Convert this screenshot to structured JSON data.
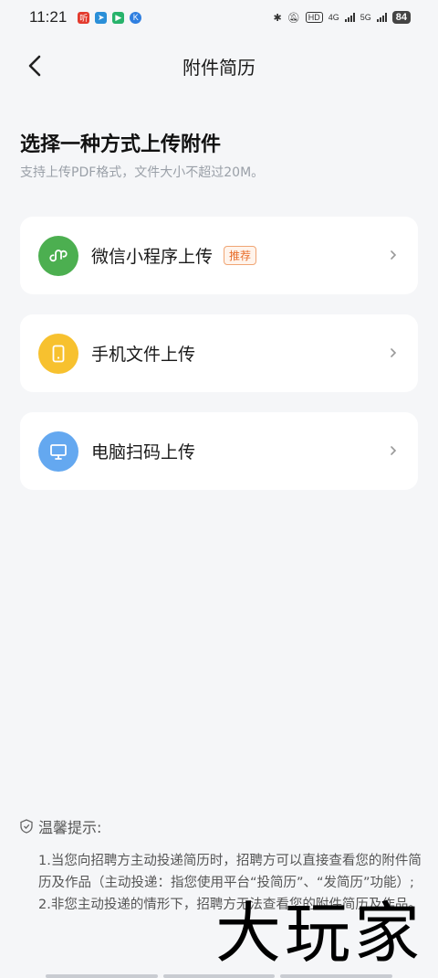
{
  "status_bar": {
    "time": "11:21",
    "apps": [
      {
        "icon": "ting-app-icon",
        "glyph": "听",
        "color": "#e33b2e"
      },
      {
        "icon": "telegram-icon",
        "glyph": "➤",
        "color": "#2a8fd8"
      },
      {
        "icon": "play-icon",
        "glyph": "▶",
        "color": "#27b36b"
      },
      {
        "icon": "k-app-icon",
        "glyph": "K",
        "color": "#2f7fe0"
      }
    ],
    "network_labels": [
      "HD",
      "4G",
      "5G"
    ],
    "battery": "84"
  },
  "nav": {
    "title": "附件简历"
  },
  "intro": {
    "heading": "选择一种方式上传附件",
    "subheading": "支持上传PDF格式，文件大小不超过20M。"
  },
  "options": [
    {
      "label": "微信小程序上传",
      "badge": "推荐",
      "icon": "wechat-miniprogram-icon",
      "icon_color": "#4caf50"
    },
    {
      "label": "手机文件上传",
      "badge": "",
      "icon": "phone-icon",
      "icon_color": "#f7c12f"
    },
    {
      "label": "电脑扫码上传",
      "badge": "",
      "icon": "computer-icon",
      "icon_color": "#64a8f0"
    }
  ],
  "tips": {
    "title": "温馨提示:",
    "line1": "1.当您向招聘方主动投递简历时，招聘方可以直接查看您的附件简历及作品（主动投递：指您使用平台“投简历”、“发简历”功能）;",
    "line2": "2.非您主动投递的情形下，招聘方无法查看您的附件简历及作品。"
  },
  "watermark": "大玩家"
}
